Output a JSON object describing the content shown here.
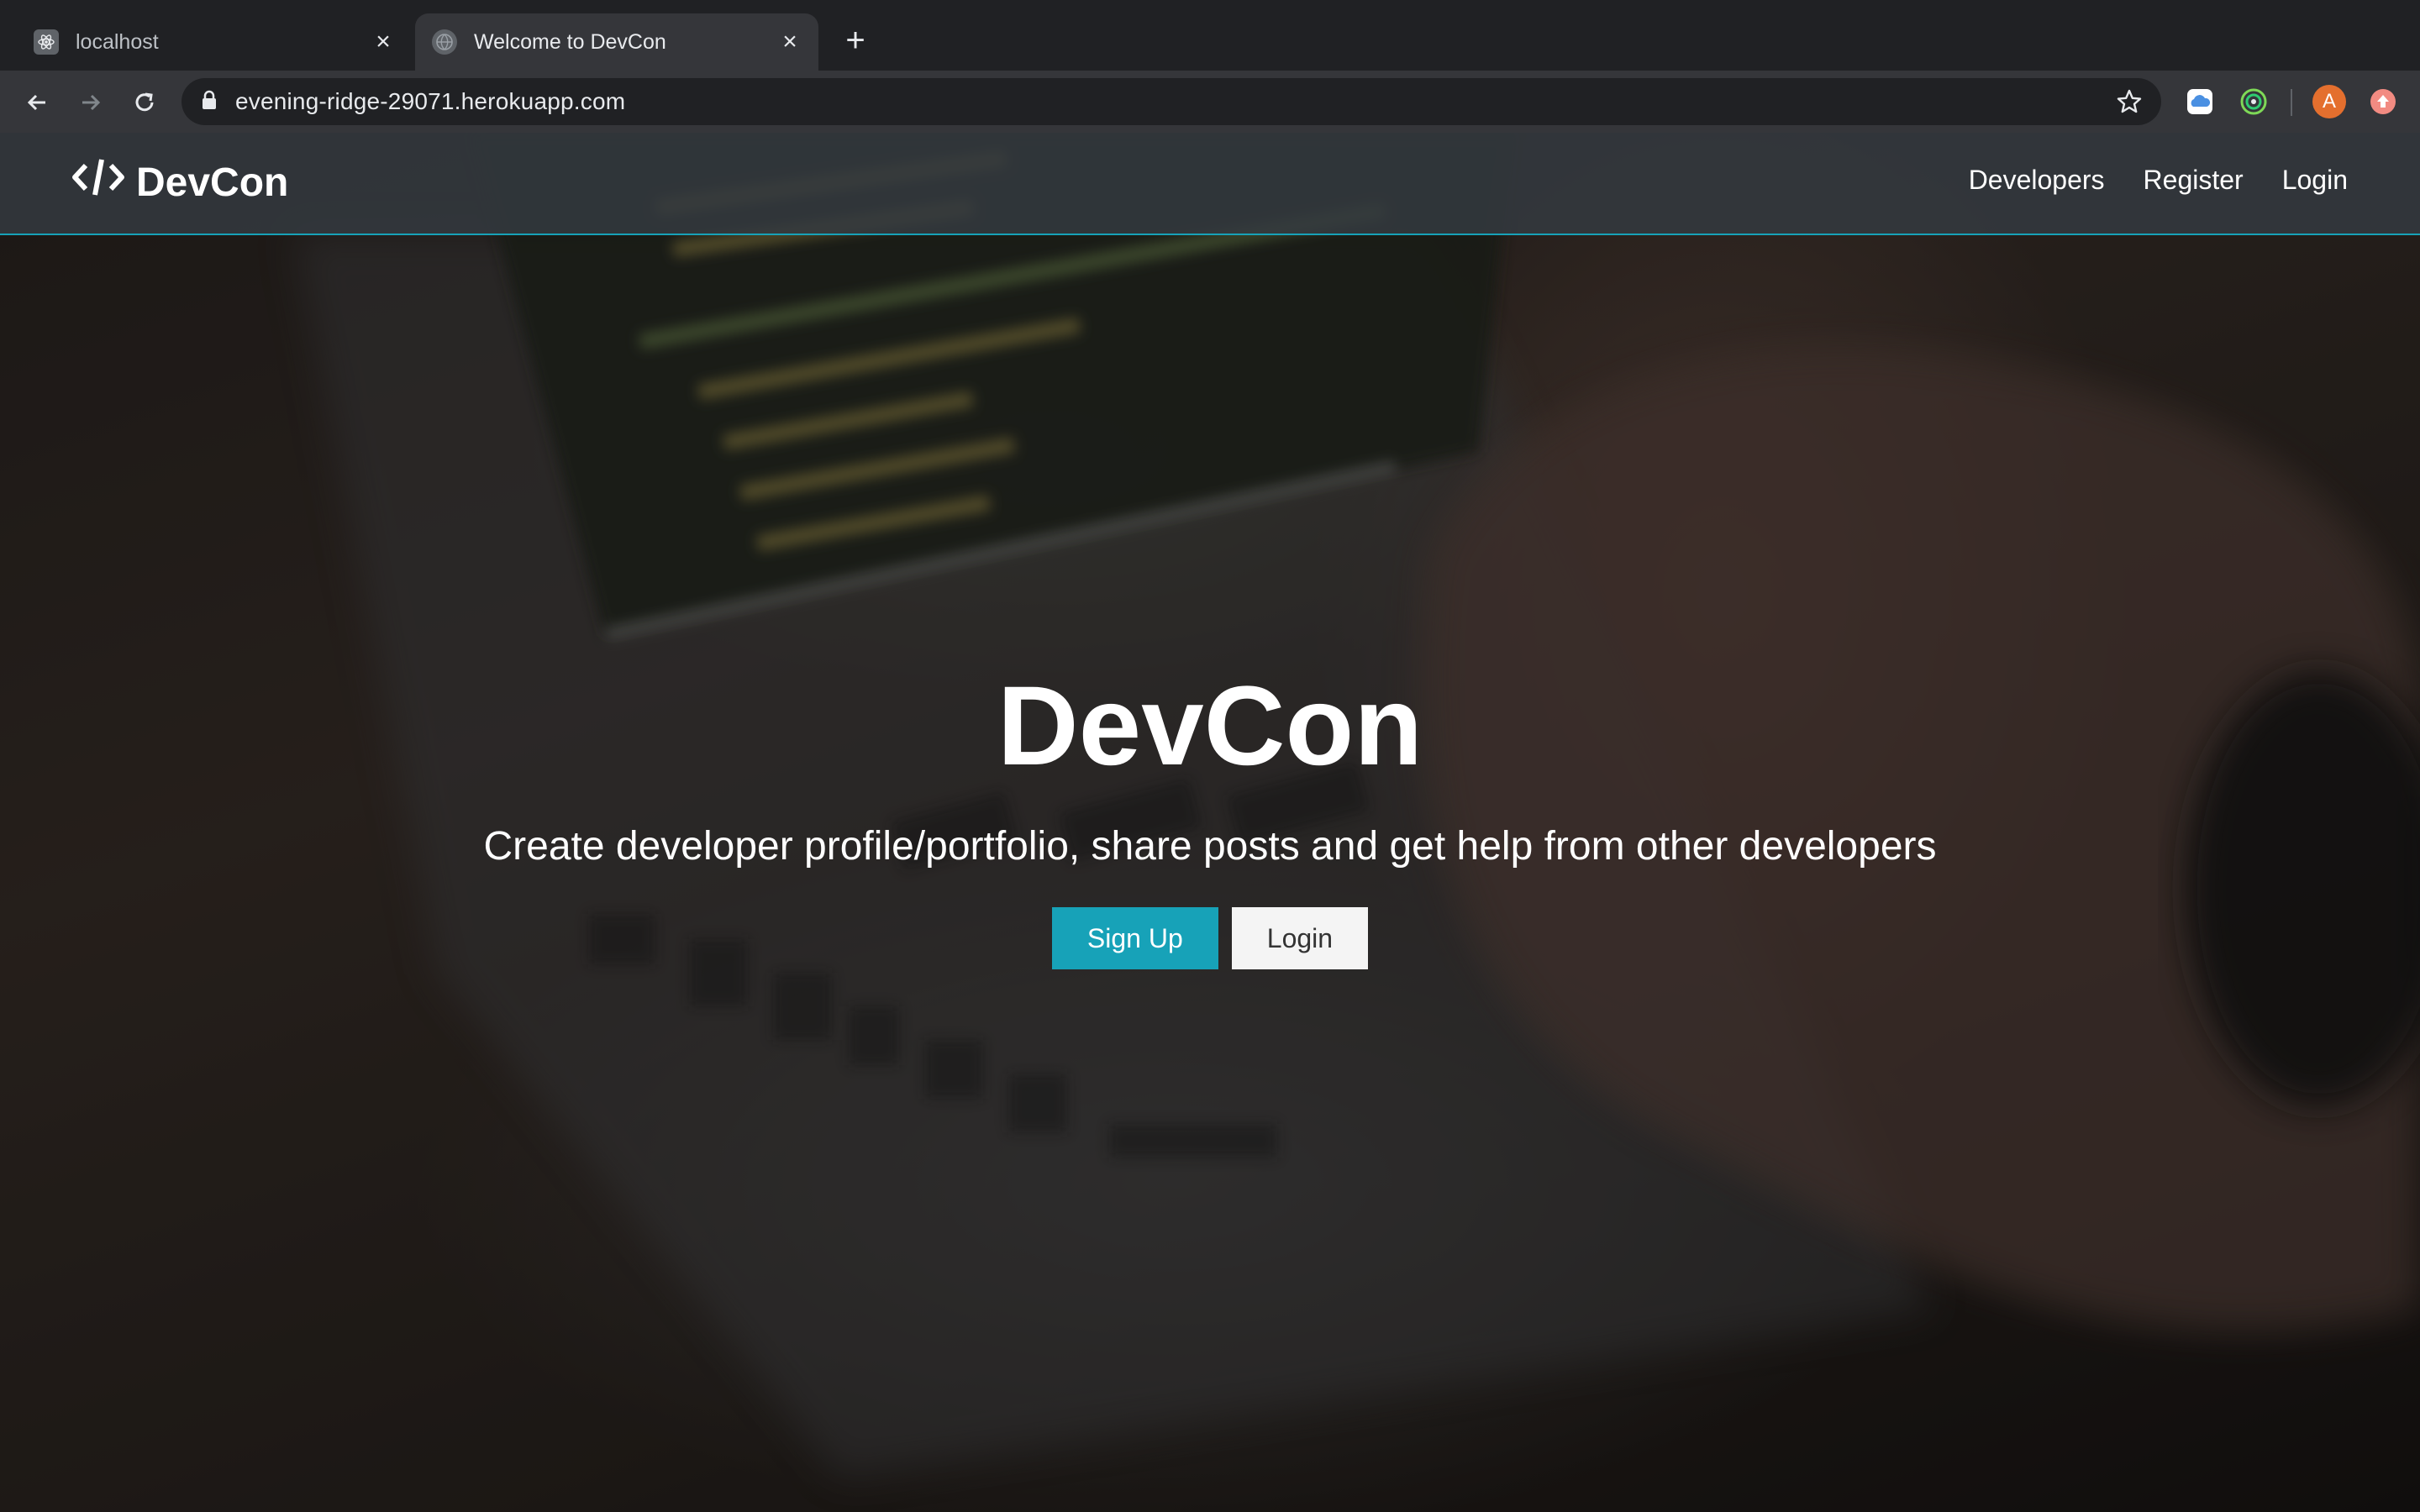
{
  "browser": {
    "tabs": [
      {
        "title": "localhost",
        "active": false,
        "favicon": "react-icon"
      },
      {
        "title": "Welcome to DevCon",
        "active": true,
        "favicon": "globe-icon"
      }
    ],
    "url": "evening-ridge-29071.herokuapp.com",
    "profile_initial": "A",
    "colors": {
      "tabbar": "#202124",
      "toolbar": "#35363a",
      "avatar": "#e46f2e"
    }
  },
  "site": {
    "brand": "DevCon",
    "nav": {
      "developers": "Developers",
      "register": "Register",
      "login": "Login"
    },
    "hero": {
      "title": "DevCon",
      "lead": "Create developer profile/portfolio, share posts and get help from other developers",
      "signup": "Sign Up",
      "login": "Login"
    },
    "colors": {
      "accent": "#17a2b8",
      "navbar": "#343a40"
    }
  }
}
